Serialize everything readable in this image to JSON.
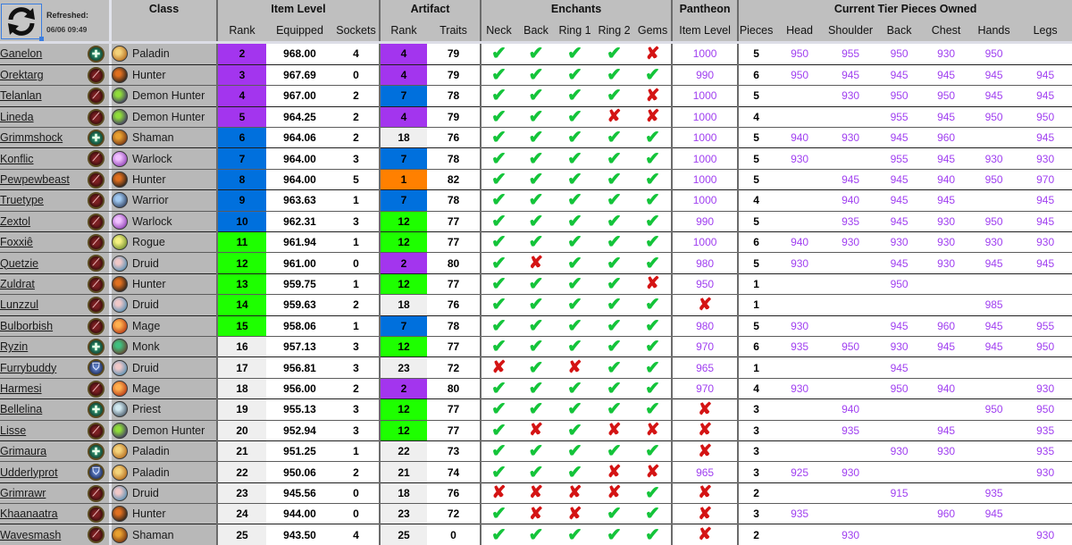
{
  "header": {
    "refresh_label": "Refreshed:",
    "refresh_time": "06/06 09:49",
    "refresh_icon": "refresh-icon",
    "groups": {
      "class": "Class",
      "item_level": "Item Level",
      "artifact": "Artifact",
      "enchants": "Enchants",
      "pantheon": "Pantheon",
      "tier": "Current Tier Pieces Owned"
    },
    "columns": {
      "ilvl_rank": "Rank",
      "equipped": "Equipped",
      "sockets": "Sockets",
      "art_rank": "Rank",
      "traits": "Traits",
      "neck": "Neck",
      "back": "Back",
      "ring1": "Ring 1",
      "ring2": "Ring 2",
      "gems": "Gems",
      "pantheon_ilvl": "Item Level",
      "pieces": "Pieces",
      "head": "Head",
      "shoulder": "Shoulder",
      "tier_back": "Back",
      "chest": "Chest",
      "hands": "Hands",
      "legs": "Legs"
    }
  },
  "colors": {
    "rank_purple": "#a335ee",
    "rank_blue": "#0070dd",
    "rank_green": "#1eff00",
    "rank_orange": "#ff8000",
    "rank_default": "#efefef",
    "check_green": "#14c43a",
    "cross_red": "#d41414",
    "ilvl_purple": "#a040f0"
  },
  "rows": [
    {
      "name": "Ganelon",
      "role": "healer",
      "cls": "Paladin",
      "rank": "2",
      "rank_color": "purple",
      "equipped": "968.00",
      "sockets": "4",
      "art_rank": "4",
      "art_color": "purple",
      "traits": "79",
      "neck": true,
      "back": true,
      "ring1": true,
      "ring2": true,
      "gems": false,
      "pantheon": "1000",
      "pieces": "5",
      "head": "950",
      "shoulder": "955",
      "tback": "950",
      "chest": "930",
      "hands": "950",
      "legs": ""
    },
    {
      "name": "Orektarg",
      "role": "dps",
      "cls": "Hunter",
      "rank": "3",
      "rank_color": "purple",
      "equipped": "967.69",
      "sockets": "0",
      "art_rank": "4",
      "art_color": "purple",
      "traits": "79",
      "neck": true,
      "back": true,
      "ring1": true,
      "ring2": true,
      "gems": true,
      "pantheon": "990",
      "pieces": "6",
      "head": "950",
      "shoulder": "945",
      "tback": "945",
      "chest": "945",
      "hands": "945",
      "legs": "945"
    },
    {
      "name": "Telanlan",
      "role": "dps",
      "cls": "Demon Hunter",
      "rank": "4",
      "rank_color": "purple",
      "equipped": "967.00",
      "sockets": "2",
      "art_rank": "7",
      "art_color": "blue",
      "traits": "78",
      "neck": true,
      "back": true,
      "ring1": true,
      "ring2": true,
      "gems": false,
      "pantheon": "1000",
      "pieces": "5",
      "head": "",
      "shoulder": "930",
      "tback": "950",
      "chest": "950",
      "hands": "945",
      "legs": "945"
    },
    {
      "name": "Lineda",
      "role": "dps",
      "cls": "Demon Hunter",
      "rank": "5",
      "rank_color": "purple",
      "equipped": "964.25",
      "sockets": "2",
      "art_rank": "4",
      "art_color": "purple",
      "traits": "79",
      "neck": true,
      "back": true,
      "ring1": true,
      "ring2": false,
      "gems": false,
      "pantheon": "1000",
      "pieces": "4",
      "head": "",
      "shoulder": "",
      "tback": "955",
      "chest": "945",
      "hands": "950",
      "legs": "950"
    },
    {
      "name": "Grimmshock",
      "role": "healer",
      "cls": "Shaman",
      "rank": "6",
      "rank_color": "blue",
      "equipped": "964.06",
      "sockets": "2",
      "art_rank": "18",
      "art_color": "default",
      "traits": "76",
      "neck": true,
      "back": true,
      "ring1": true,
      "ring2": true,
      "gems": true,
      "pantheon": "1000",
      "pieces": "5",
      "head": "940",
      "shoulder": "930",
      "tback": "945",
      "chest": "960",
      "hands": "",
      "legs": "945"
    },
    {
      "name": "Konflic",
      "role": "dps",
      "cls": "Warlock",
      "rank": "7",
      "rank_color": "blue",
      "equipped": "964.00",
      "sockets": "3",
      "art_rank": "7",
      "art_color": "blue",
      "traits": "78",
      "neck": true,
      "back": true,
      "ring1": true,
      "ring2": true,
      "gems": true,
      "pantheon": "1000",
      "pieces": "5",
      "head": "930",
      "shoulder": "",
      "tback": "955",
      "chest": "945",
      "hands": "930",
      "legs": "930"
    },
    {
      "name": "Pewpewbeast",
      "role": "dps",
      "cls": "Hunter",
      "rank": "8",
      "rank_color": "blue",
      "equipped": "964.00",
      "sockets": "5",
      "art_rank": "1",
      "art_color": "orange",
      "traits": "82",
      "neck": true,
      "back": true,
      "ring1": true,
      "ring2": true,
      "gems": true,
      "pantheon": "1000",
      "pieces": "5",
      "head": "",
      "shoulder": "945",
      "tback": "945",
      "chest": "940",
      "hands": "950",
      "legs": "970"
    },
    {
      "name": "Truetype",
      "role": "dps",
      "cls": "Warrior",
      "rank": "9",
      "rank_color": "blue",
      "equipped": "963.63",
      "sockets": "1",
      "art_rank": "7",
      "art_color": "blue",
      "traits": "78",
      "neck": true,
      "back": true,
      "ring1": true,
      "ring2": true,
      "gems": true,
      "pantheon": "1000",
      "pieces": "4",
      "head": "",
      "shoulder": "940",
      "tback": "945",
      "chest": "945",
      "hands": "",
      "legs": "945"
    },
    {
      "name": "Zextol",
      "role": "dps",
      "cls": "Warlock",
      "rank": "10",
      "rank_color": "blue",
      "equipped": "962.31",
      "sockets": "3",
      "art_rank": "12",
      "art_color": "green",
      "traits": "77",
      "neck": true,
      "back": true,
      "ring1": true,
      "ring2": true,
      "gems": true,
      "pantheon": "990",
      "pieces": "5",
      "head": "",
      "shoulder": "935",
      "tback": "945",
      "chest": "930",
      "hands": "950",
      "legs": "945"
    },
    {
      "name": "Foxxiê",
      "role": "dps",
      "cls": "Rogue",
      "rank": "11",
      "rank_color": "green",
      "equipped": "961.94",
      "sockets": "1",
      "art_rank": "12",
      "art_color": "green",
      "traits": "77",
      "neck": true,
      "back": true,
      "ring1": true,
      "ring2": true,
      "gems": true,
      "pantheon": "1000",
      "pieces": "6",
      "head": "940",
      "shoulder": "930",
      "tback": "930",
      "chest": "930",
      "hands": "930",
      "legs": "930"
    },
    {
      "name": "Quetzie",
      "role": "dps",
      "cls": "Druid",
      "rank": "12",
      "rank_color": "green",
      "equipped": "961.00",
      "sockets": "0",
      "art_rank": "2",
      "art_color": "purple",
      "traits": "80",
      "neck": true,
      "back": false,
      "ring1": true,
      "ring2": true,
      "gems": true,
      "pantheon": "980",
      "pieces": "5",
      "head": "930",
      "shoulder": "",
      "tback": "945",
      "chest": "930",
      "hands": "945",
      "legs": "945"
    },
    {
      "name": "Zuldrat",
      "role": "dps",
      "cls": "Hunter",
      "rank": "13",
      "rank_color": "green",
      "equipped": "959.75",
      "sockets": "1",
      "art_rank": "12",
      "art_color": "green",
      "traits": "77",
      "neck": true,
      "back": true,
      "ring1": true,
      "ring2": true,
      "gems": false,
      "pantheon": "950",
      "pieces": "1",
      "head": "",
      "shoulder": "",
      "tback": "950",
      "chest": "",
      "hands": "",
      "legs": ""
    },
    {
      "name": "Lunzzul",
      "role": "dps",
      "cls": "Druid",
      "rank": "14",
      "rank_color": "green",
      "equipped": "959.63",
      "sockets": "2",
      "art_rank": "18",
      "art_color": "default",
      "traits": "76",
      "neck": true,
      "back": true,
      "ring1": true,
      "ring2": true,
      "gems": true,
      "pantheon": null,
      "pieces": "1",
      "head": "",
      "shoulder": "",
      "tback": "",
      "chest": "",
      "hands": "985",
      "legs": ""
    },
    {
      "name": "Bulborbish",
      "role": "dps",
      "cls": "Mage",
      "rank": "15",
      "rank_color": "green",
      "equipped": "958.06",
      "sockets": "1",
      "art_rank": "7",
      "art_color": "blue",
      "traits": "78",
      "neck": true,
      "back": true,
      "ring1": true,
      "ring2": true,
      "gems": true,
      "pantheon": "980",
      "pieces": "5",
      "head": "930",
      "shoulder": "",
      "tback": "945",
      "chest": "960",
      "hands": "945",
      "legs": "955"
    },
    {
      "name": "Ryzin",
      "role": "healer",
      "cls": "Monk",
      "rank": "16",
      "rank_color": "default",
      "equipped": "957.13",
      "sockets": "3",
      "art_rank": "12",
      "art_color": "green",
      "traits": "77",
      "neck": true,
      "back": true,
      "ring1": true,
      "ring2": true,
      "gems": true,
      "pantheon": "970",
      "pieces": "6",
      "head": "935",
      "shoulder": "950",
      "tback": "930",
      "chest": "945",
      "hands": "945",
      "legs": "950"
    },
    {
      "name": "Furrybuddy",
      "role": "tank",
      "cls": "Druid",
      "rank": "17",
      "rank_color": "default",
      "equipped": "956.81",
      "sockets": "3",
      "art_rank": "23",
      "art_color": "default",
      "traits": "72",
      "neck": false,
      "back": true,
      "ring1": false,
      "ring2": true,
      "gems": true,
      "pantheon": "965",
      "pieces": "1",
      "head": "",
      "shoulder": "",
      "tback": "945",
      "chest": "",
      "hands": "",
      "legs": ""
    },
    {
      "name": "Harmesi",
      "role": "dps",
      "cls": "Mage",
      "rank": "18",
      "rank_color": "default",
      "equipped": "956.00",
      "sockets": "2",
      "art_rank": "2",
      "art_color": "purple",
      "traits": "80",
      "neck": true,
      "back": true,
      "ring1": true,
      "ring2": true,
      "gems": true,
      "pantheon": "970",
      "pieces": "4",
      "head": "930",
      "shoulder": "",
      "tback": "950",
      "chest": "940",
      "hands": "",
      "legs": "930"
    },
    {
      "name": "Bellelina",
      "role": "healer",
      "cls": "Priest",
      "rank": "19",
      "rank_color": "default",
      "equipped": "955.13",
      "sockets": "3",
      "art_rank": "12",
      "art_color": "green",
      "traits": "77",
      "neck": true,
      "back": true,
      "ring1": true,
      "ring2": true,
      "gems": true,
      "pantheon": null,
      "pieces": "3",
      "head": "",
      "shoulder": "940",
      "tback": "",
      "chest": "",
      "hands": "950",
      "legs": "950"
    },
    {
      "name": "Lisse",
      "role": "dps",
      "cls": "Demon Hunter",
      "rank": "20",
      "rank_color": "default",
      "equipped": "952.94",
      "sockets": "3",
      "art_rank": "12",
      "art_color": "green",
      "traits": "77",
      "neck": true,
      "back": false,
      "ring1": true,
      "ring2": false,
      "gems": false,
      "pantheon": null,
      "pieces": "3",
      "head": "",
      "shoulder": "935",
      "tback": "",
      "chest": "945",
      "hands": "",
      "legs": "935"
    },
    {
      "name": "Grimaura",
      "role": "healer",
      "cls": "Paladin",
      "rank": "21",
      "rank_color": "default",
      "equipped": "951.25",
      "sockets": "1",
      "art_rank": "22",
      "art_color": "default",
      "traits": "73",
      "neck": true,
      "back": true,
      "ring1": true,
      "ring2": true,
      "gems": true,
      "pantheon": null,
      "pieces": "3",
      "head": "",
      "shoulder": "",
      "tback": "930",
      "chest": "930",
      "hands": "",
      "legs": "935"
    },
    {
      "name": "Udderlyprot",
      "role": "tank",
      "cls": "Paladin",
      "rank": "22",
      "rank_color": "default",
      "equipped": "950.06",
      "sockets": "2",
      "art_rank": "21",
      "art_color": "default",
      "traits": "74",
      "neck": true,
      "back": true,
      "ring1": true,
      "ring2": false,
      "gems": false,
      "pantheon": "965",
      "pieces": "3",
      "head": "925",
      "shoulder": "930",
      "tback": "",
      "chest": "",
      "hands": "",
      "legs": "930"
    },
    {
      "name": "Grimrawr",
      "role": "dps",
      "cls": "Druid",
      "rank": "23",
      "rank_color": "default",
      "equipped": "945.56",
      "sockets": "0",
      "art_rank": "18",
      "art_color": "default",
      "traits": "76",
      "neck": false,
      "back": false,
      "ring1": false,
      "ring2": false,
      "gems": true,
      "pantheon": null,
      "pieces": "2",
      "head": "",
      "shoulder": "",
      "tback": "915",
      "chest": "",
      "hands": "935",
      "legs": ""
    },
    {
      "name": "Khaanaatra",
      "role": "dps",
      "cls": "Hunter",
      "rank": "24",
      "rank_color": "default",
      "equipped": "944.00",
      "sockets": "0",
      "art_rank": "23",
      "art_color": "default",
      "traits": "72",
      "neck": true,
      "back": false,
      "ring1": false,
      "ring2": true,
      "gems": true,
      "pantheon": null,
      "pieces": "3",
      "head": "935",
      "shoulder": "",
      "tback": "",
      "chest": "960",
      "hands": "945",
      "legs": ""
    },
    {
      "name": "Wavesmash",
      "role": "dps",
      "cls": "Shaman",
      "rank": "25",
      "rank_color": "default",
      "equipped": "943.50",
      "sockets": "4",
      "art_rank": "25",
      "art_color": "default",
      "traits": "0",
      "neck": true,
      "back": true,
      "ring1": true,
      "ring2": true,
      "gems": true,
      "pantheon": null,
      "pieces": "2",
      "head": "",
      "shoulder": "930",
      "tback": "",
      "chest": "",
      "hands": "",
      "legs": "930"
    }
  ],
  "class_icon_colors": {
    "Paladin": [
      "#f4d27a",
      "#b0651a"
    ],
    "Hunter": [
      "#e07020",
      "#1a1a1a"
    ],
    "Demon Hunter": [
      "#8fdc3a",
      "#3a2a6a"
    ],
    "Shaman": [
      "#e8a030",
      "#6a2a10"
    ],
    "Warlock": [
      "#f0c0ff",
      "#8a3ab0"
    ],
    "Warrior": [
      "#a0c8f0",
      "#2a3a5a"
    ],
    "Rogue": [
      "#f4f080",
      "#6a8a2a"
    ],
    "Druid": [
      "#f0c8c8",
      "#4a8ab0"
    ],
    "Mage": [
      "#ffb050",
      "#b03010"
    ],
    "Monk": [
      "#40c080",
      "#6a3a2a"
    ],
    "Priest": [
      "#d0e8f0",
      "#405060"
    ]
  }
}
